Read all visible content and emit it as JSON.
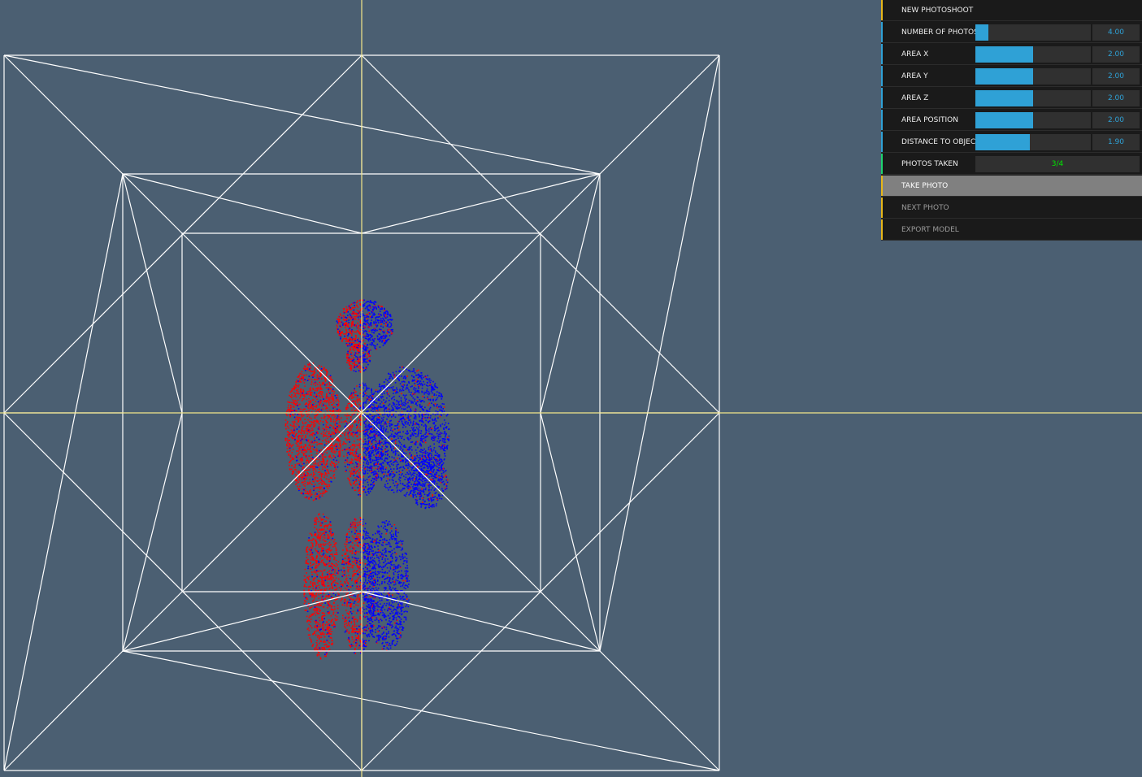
{
  "colors": {
    "background": "#4b5f72",
    "axis": "#f2e68a",
    "wireframe": "#ffffff",
    "points_red": "#ff0000",
    "points_blue": "#0000ff",
    "slider_fill": "#2fa1d6",
    "stripe_folder": "#e6b619",
    "stripe_number": "#2fa1d6",
    "stripe_readout": "#1ed36f"
  },
  "viewport": {
    "objects": [
      "axis-lines",
      "capture-area-wireframe",
      "point-cloud-person"
    ]
  },
  "panel": {
    "new_photoshoot": "NEW PHOTOSHOOT",
    "sliders": [
      {
        "name": "slider-number-of-photos",
        "label": "NUMBER OF PHOTOS",
        "value": "4.00",
        "level": 0.11
      },
      {
        "name": "slider-area-x",
        "label": "AREA X",
        "value": "2.00",
        "level": 0.5
      },
      {
        "name": "slider-area-y",
        "label": "AREA Y",
        "value": "2.00",
        "level": 0.5
      },
      {
        "name": "slider-area-z",
        "label": "AREA Z",
        "value": "2.00",
        "level": 0.5
      },
      {
        "name": "slider-area-position",
        "label": "AREA POSITION",
        "value": "2.00",
        "level": 0.5
      },
      {
        "name": "slider-distance-to-object",
        "label": "DISTANCE TO OBJECT",
        "value": "1.90",
        "level": 0.475
      }
    ],
    "photos_taken": {
      "label": "PHOTOS TAKEN",
      "value": "3/4"
    },
    "take_photo": "TAKE PHOTO",
    "next_photo": "NEXT PHOTO",
    "export_model": "EXPORT MODEL"
  }
}
